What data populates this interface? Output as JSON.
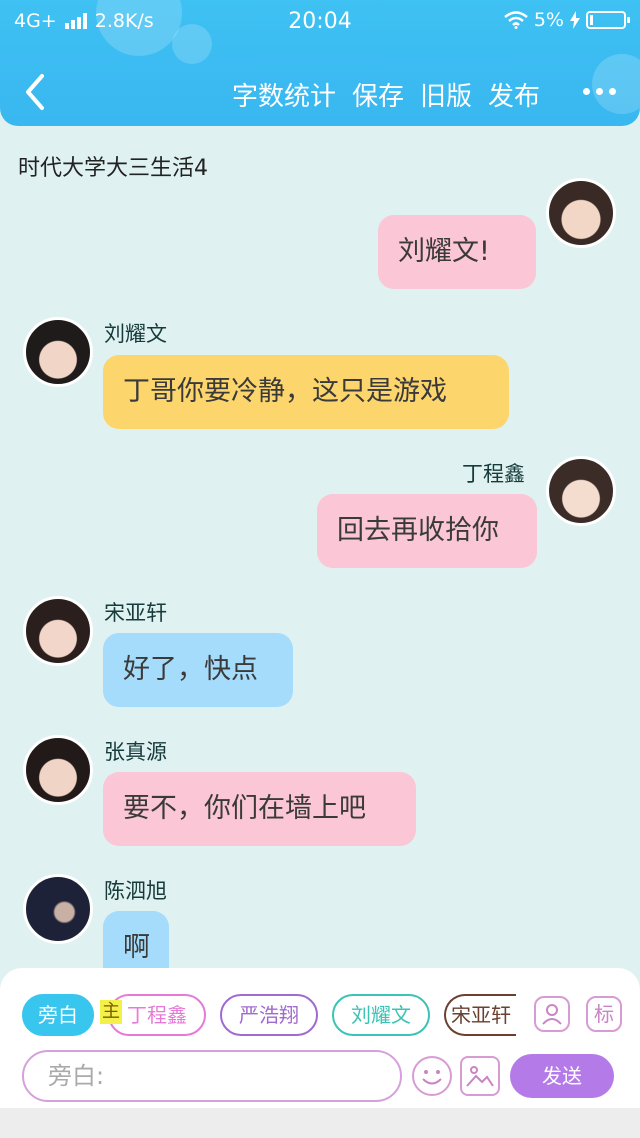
{
  "status": {
    "network": "4G+",
    "speed": "2.8K/s",
    "time": "20:04",
    "battery": "5%"
  },
  "toolbar": {
    "word_count": "字数统计",
    "save": "保存",
    "old_version": "旧版",
    "publish": "发布"
  },
  "story_title": "时代大学大三生活4",
  "messages": [
    {
      "side": "right",
      "name": "",
      "text": "刘耀文!",
      "color": "pink"
    },
    {
      "side": "left",
      "name": "刘耀文",
      "text": "丁哥你要冷静，这只是游戏",
      "color": "yellow"
    },
    {
      "side": "right",
      "name": "丁程鑫",
      "text": "回去再收拾你",
      "color": "pink"
    },
    {
      "side": "left",
      "name": "宋亚轩",
      "text": "好了，快点",
      "color": "blue"
    },
    {
      "side": "left",
      "name": "张真源",
      "text": "要不，你们在墙上吧",
      "color": "pink"
    },
    {
      "side": "left",
      "name": "陈泗旭",
      "text": "啊",
      "color": "blue"
    }
  ],
  "characters": [
    {
      "label": "旁白",
      "color": "#38c6ef",
      "active": true
    },
    {
      "label": "丁程鑫",
      "color": "#e57bd7",
      "active": false
    },
    {
      "label": "严浩翔",
      "color": "#a06bd0",
      "active": false
    },
    {
      "label": "刘耀文",
      "color": "#3cc3b5",
      "active": false
    },
    {
      "label": "宋亚轩",
      "color": "#6b4030",
      "active": false
    }
  ],
  "main_marker": "主",
  "icons": {
    "add_role": "person-icon",
    "tag_label": "标"
  },
  "input": {
    "placeholder": "旁白:"
  },
  "send_label": "发送",
  "colors": {
    "header": "#3ec1f3",
    "background": "#dff1f1",
    "pink_bubble": "#fbc6d5",
    "yellow_bubble": "#fcd66c",
    "blue_bubble": "#a6dcfb",
    "send": "#b47be8"
  }
}
